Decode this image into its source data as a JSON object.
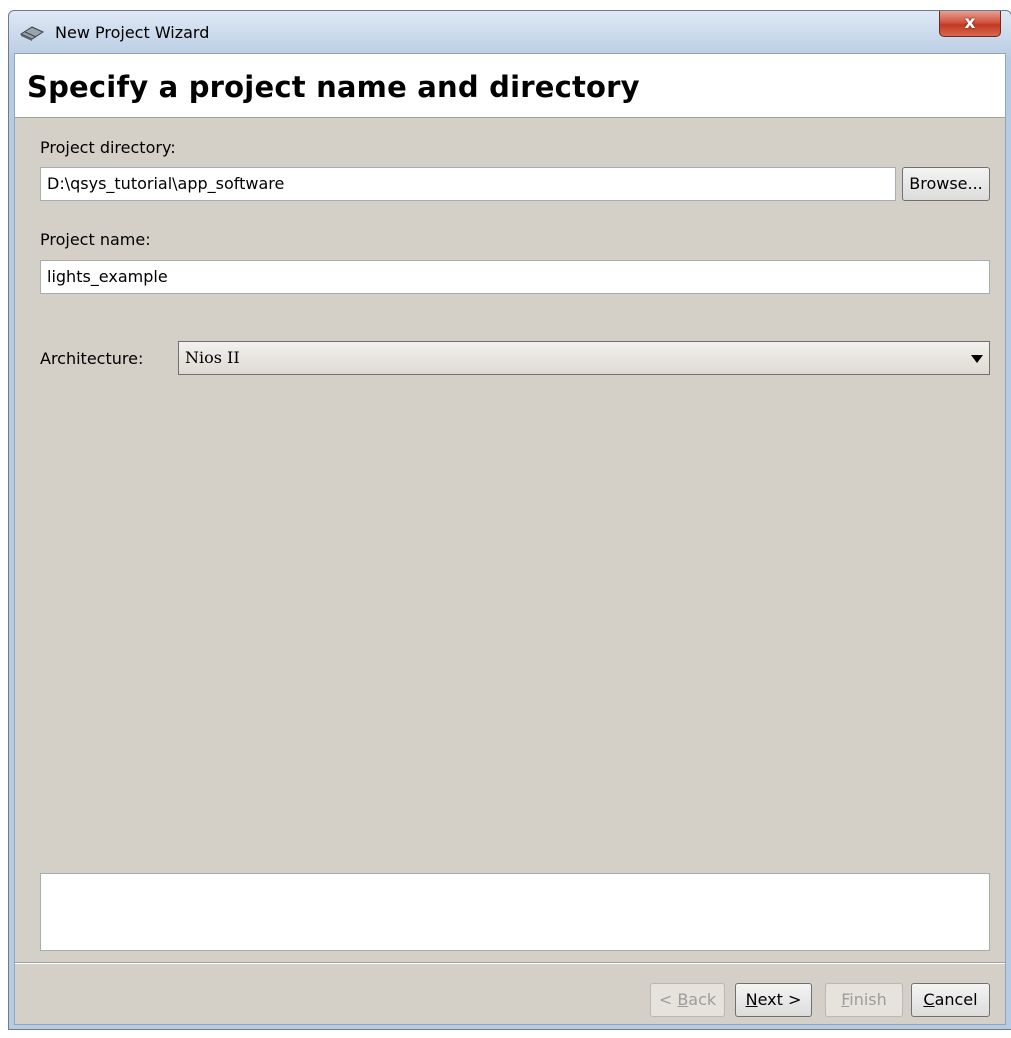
{
  "window": {
    "title": "New Project Wizard",
    "close_label": "x"
  },
  "banner": {
    "title": "Specify a project name and directory"
  },
  "form": {
    "directory_label": "Project directory:",
    "directory_value": "D:\\qsys_tutorial\\app_software",
    "browse_label": "Browse...",
    "name_label": "Project name:",
    "name_value": "lights_example",
    "architecture_label": "Architecture:",
    "architecture_value": "Nios II"
  },
  "message": "",
  "footer": {
    "back": {
      "mnemonic": "B",
      "prefix": "< ",
      "rest": "ack",
      "enabled": false
    },
    "next": {
      "mnemonic": "N",
      "prefix": "",
      "rest": "ext >",
      "enabled": true
    },
    "finish": {
      "mnemonic": "F",
      "prefix": "",
      "rest": "inish",
      "enabled": false
    },
    "cancel": {
      "mnemonic": "C",
      "prefix": "",
      "rest": "ancel",
      "enabled": true
    }
  },
  "colors": {
    "dialog_bg": "#d4d0c8",
    "banner_bg": "#ffffff",
    "close_red": "#c13a22"
  }
}
